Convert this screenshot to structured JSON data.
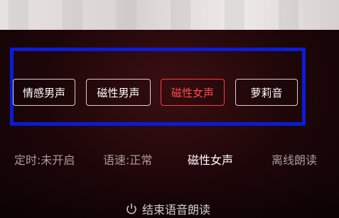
{
  "voice_options": [
    {
      "label": "情感男声",
      "active": false
    },
    {
      "label": "磁性男声",
      "active": false
    },
    {
      "label": "磁性女声",
      "active": true
    },
    {
      "label": "萝莉音",
      "active": false
    }
  ],
  "settings": {
    "timer_label": "定时:未开启",
    "speed_label": "语速:正常",
    "current_voice": "磁性女声",
    "offline_label": "离线朗读"
  },
  "actions": {
    "end_reading_label": "结束语音朗读"
  },
  "icons": {
    "end_reading_icon": "power-icon"
  },
  "colors": {
    "active_red": "#ff4b4b",
    "annotation_blue": "#0b1bd6",
    "background_dark_red": "#2a0a0d"
  }
}
